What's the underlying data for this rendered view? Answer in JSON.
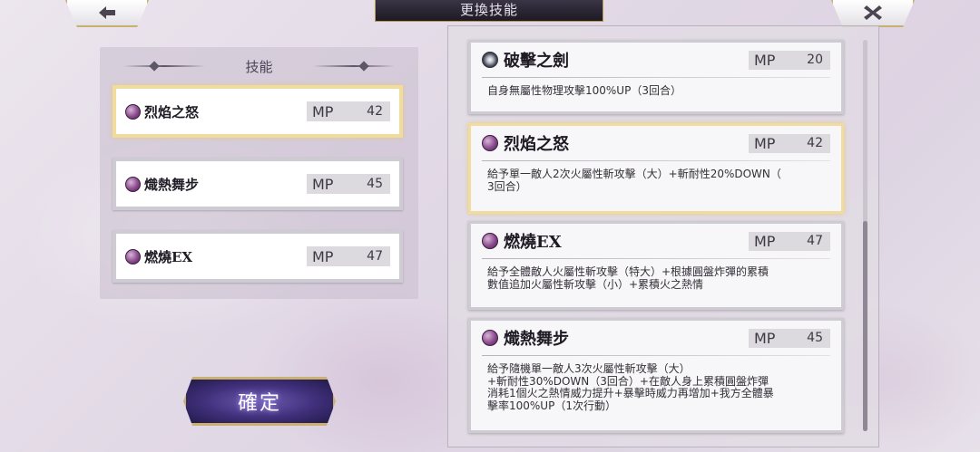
{
  "header": {
    "title": "更換技能"
  },
  "left_panel": {
    "title": "技能",
    "slots": [
      {
        "name": "烈焰之怒",
        "mp_label": "MP",
        "mp": "42"
      },
      {
        "name": "熾熱舞步",
        "mp_label": "MP",
        "mp": "45"
      },
      {
        "name": "燃燒EX",
        "mp_label": "MP",
        "mp": "47"
      }
    ]
  },
  "confirm_label": "確定",
  "skill_list": [
    {
      "name": "破擊之劍",
      "mp_label": "MP",
      "mp": "20",
      "desc": "自身無屬性物理攻擊100%UP（3回合）"
    },
    {
      "name": "烈焰之怒",
      "mp_label": "MP",
      "mp": "42",
      "desc": "給予單一敵人2次火屬性斬攻擊（大）+斬耐性20%DOWN（\n3回合）"
    },
    {
      "name": "燃燒EX",
      "mp_label": "MP",
      "mp": "47",
      "desc": "給予全體敵人火屬性斬攻擊（特大）+根據圓盤炸彈的累積\n數值追加火屬性斬攻擊（小）+累積火之熱情"
    },
    {
      "name": "熾熱舞步",
      "mp_label": "MP",
      "mp": "45",
      "desc": "給予隨機單一敵人3次火屬性斬攻擊（大）\n+斬耐性30%DOWN（3回合）+在敵人身上累積圓盤炸彈\n消耗1個火之熱情威力提升+暴擊時威力再增加+我方全體暴\n擊率100%UP（1次行動）"
    }
  ],
  "icons": {
    "back": "back-arrow-icon",
    "close": "close-x-icon",
    "skill": "flame-orb-icon",
    "skill_alt": "sword-burst-icon"
  },
  "colors": {
    "selected_border": "#f1dca0",
    "confirm_bg": "#3f2f7a",
    "title_bg": "#1d1a24"
  }
}
